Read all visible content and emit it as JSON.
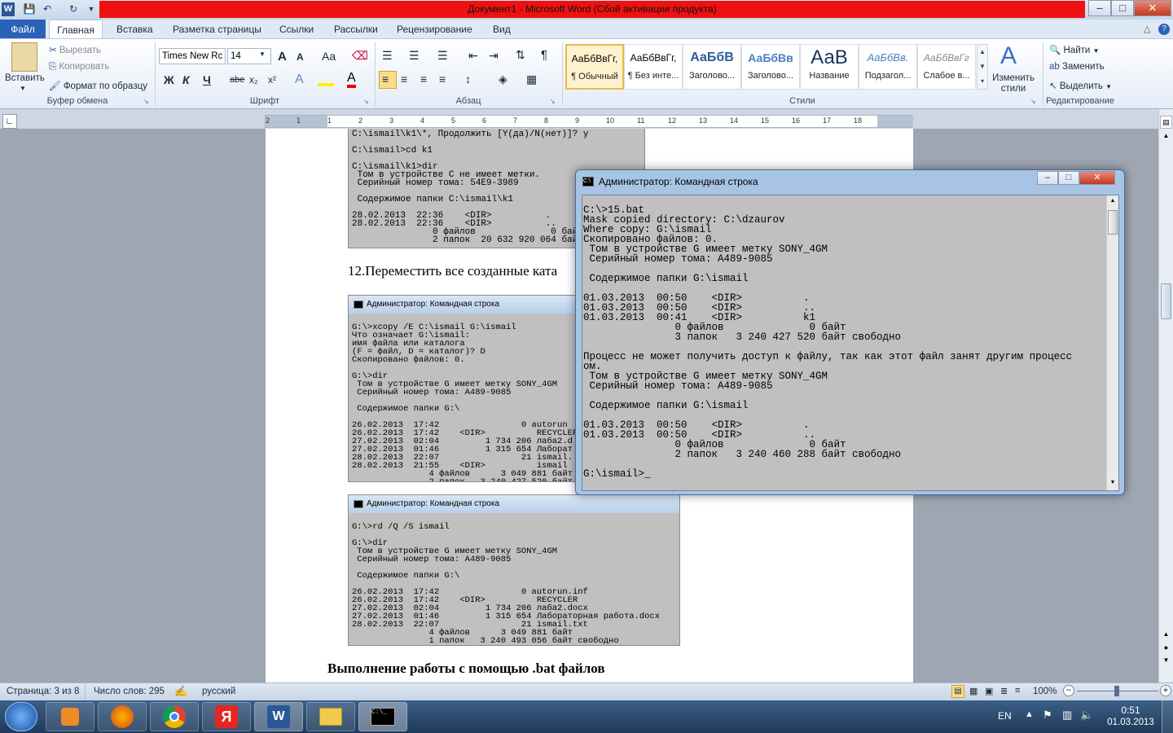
{
  "window": {
    "title": "Документ1 - Microsoft Word (Сбой активации продукта)",
    "app_icon_letter": "W",
    "minimize": "–",
    "maximize": "□",
    "close": "✕",
    "ribbon_min": "△",
    "help": "?"
  },
  "ribbon": {
    "file_tab": "Файл",
    "tabs": [
      "Главная",
      "Вставка",
      "Разметка страницы",
      "Ссылки",
      "Рассылки",
      "Рецензирование",
      "Вид"
    ],
    "clipboard": {
      "paste": "Вставить",
      "cut": "Вырезать",
      "copy": "Копировать",
      "format_painter": "Формат по образцу",
      "group": "Буфер обмена"
    },
    "font": {
      "family": "Times New Rc",
      "size": "14",
      "grow": "A",
      "shrink": "A",
      "case": "Aa",
      "bold": "Ж",
      "italic": "К",
      "underline": "Ч",
      "strike": "abe",
      "subscript": "x₂",
      "superscript": "x²",
      "group": "Шрифт"
    },
    "paragraph": {
      "group": "Абзац",
      "pilcrow": "¶"
    },
    "styles": {
      "items": [
        {
          "preview": "АаБбВвГг,",
          "name": "¶ Обычный"
        },
        {
          "preview": "АаБбВвГг,",
          "name": "¶ Без инте..."
        },
        {
          "preview": "АаБбВ",
          "name": "Заголово..."
        },
        {
          "preview": "АаБбВв",
          "name": "Заголово..."
        },
        {
          "preview": "АаВ",
          "name": "Название"
        },
        {
          "preview": "АаБбВв.",
          "name": "Подзагол..."
        },
        {
          "preview": "АаБбВвГг",
          "name": "Слабое в..."
        }
      ],
      "change": "Изменить стили",
      "group": "Стили"
    },
    "editing": {
      "find": "Найти",
      "replace": "Заменить",
      "select": "Выделить",
      "group": "Редактирование"
    }
  },
  "ruler": {
    "numbers": [
      "2",
      "1",
      "1",
      "2",
      "3",
      "4",
      "5",
      "6",
      "7",
      "8",
      "9",
      "10",
      "11",
      "12",
      "13",
      "14",
      "15",
      "16",
      "17",
      "18"
    ]
  },
  "document": {
    "shot1_text": "C:\\ismail\\k1\\*, Продолжить [Y(да)/N(нет)]? y\n\nC:\\ismail>cd k1\n\nC:\\ismail\\k1>dir\n Том в устройстве C не имеет метки.\n Серийный номер тома: 54E9-3989\n\n Содержимое папки C:\\ismail\\k1\n\n28.02.2013  22:36    <DIR>          .\n28.02.2013  22:36    <DIR>          ..\n               0 файлов              0 бай\n               2 папок  20 632 920 064 бай",
    "para12": "12.Переместить все созданные ката",
    "shot2_title": "Администратор: Командная строка",
    "shot2_text": "G:\\>xcopy /E C:\\ismail G:\\ismail\nЧто означает G:\\ismail:\nимя файла или каталога\n(F = файл, D = каталог)? D\nСкопировано файлов: 0.\n\nG:\\>dir\n Том в устройстве G имеет метку SONY_4GM\n Серийный номер тома: A489-9085\n\n Содержимое папки G:\\\n\n26.02.2013  17:42                0 autorun\n26.02.2013  17:42    <DIR>          RECYCLER\n27.02.2013  02:04         1 734 206 лаба2.d\n27.02.2013  01:46         1 315 654 Лаборат\n28.02.2013  22:07                21 ismail.\n28.02.2013  21:55    <DIR>          ismail\n               4 файлов      3 049 881 байт\n               2 папок   3 240 427 520 байт",
    "shot3_title": "Администратор: Командная строка",
    "shot3_text": "G:\\>rd /Q /S ismail\n\nG:\\>dir\n Том в устройстве G имеет метку SONY_4GM\n Серийный номер тома: A489-9085\n\n Содержимое папки G:\\\n\n26.02.2013  17:42                0 autorun.inf\n26.02.2013  17:42    <DIR>          RECYCLER\n27.02.2013  02:04         1 734 206 лаба2.docx\n27.02.2013  01:46         1 315 654 Лабораторная работа.docx\n28.02.2013  22:07                21 ismail.txt\n               4 файлов      3 049 881 байт\n               1 папок   3 240 493 056 байт свободно",
    "heading": "Выполнение работы с помощью .bat файлов"
  },
  "cmd": {
    "title": "Администратор: Командная строка",
    "text": "C:\\>15.bat\nMask copied directory: C:\\dzaurov\nWhere copy: G:\\ismail\nСкопировано файлов: 0.\n Том в устройстве G имеет метку SONY_4GM\n Серийный номер тома: A489-9085\n\n Содержимое папки G:\\ismail\n\n01.03.2013  00:50    <DIR>          .\n01.03.2013  00:50    <DIR>          ..\n01.03.2013  00:41    <DIR>          k1\n               0 файлов              0 байт\n               3 папок   3 240 427 520 байт свободно\n\nПроцесс не может получить доступ к файлу, так как этот файл занят другим процесс\nом.\n Том в устройстве G имеет метку SONY_4GM\n Серийный номер тома: A489-9085\n\n Содержимое папки G:\\ismail\n\n01.03.2013  00:50    <DIR>          .\n01.03.2013  00:50    <DIR>          ..\n               0 файлов              0 байт\n               2 папок   3 240 460 288 байт свободно\n\nG:\\ismail>_"
  },
  "status": {
    "page": "Страница: 3 из 8",
    "words": "Число слов: 295",
    "language": "русский",
    "zoom": "100%",
    "zoom_minus": "−",
    "zoom_plus": "+"
  },
  "taskbar": {
    "lang": "EN",
    "time": "0:51",
    "date": "01.03.2013"
  },
  "colors": {
    "title_red": "#ee1111",
    "file_tab": "#2a62b8"
  }
}
